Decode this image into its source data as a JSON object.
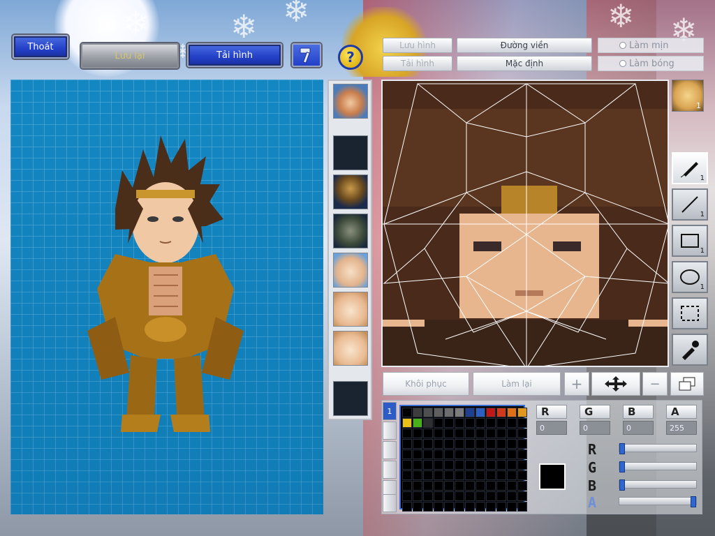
{
  "toolbar": {
    "exit_label": "Thoát",
    "save_label": "Lưu lại",
    "reload_label": "Tải hình",
    "hammer_icon": "hammer-icon",
    "help_icon": "help-icon",
    "help_glyph": "?"
  },
  "options": {
    "save_image": "Lưu hình",
    "load_image": "Tải hình",
    "outline": "Đường viền",
    "default": "Mặc định",
    "smooth": "Làm mịn",
    "shiny": "Làm bóng"
  },
  "editor": {
    "undo_label": "Khôi phục",
    "redo_label": "Làm lại",
    "face_badge": "1"
  },
  "tools": [
    {
      "name": "pen-icon",
      "count": "1",
      "active": true
    },
    {
      "name": "line-icon",
      "count": "1",
      "active": false
    },
    {
      "name": "rectangle-icon",
      "count": "1",
      "active": false
    },
    {
      "name": "ellipse-icon",
      "count": "1",
      "active": false
    },
    {
      "name": "selection-icon",
      "count": "",
      "active": false
    },
    {
      "name": "eyedropper-icon",
      "count": "",
      "active": false
    }
  ],
  "palette": {
    "tab_label": "1",
    "channels": {
      "R": {
        "label": "R",
        "value": "0"
      },
      "G": {
        "label": "G",
        "value": "0"
      },
      "B": {
        "label": "B",
        "value": "0"
      },
      "A": {
        "label": "A",
        "value": "255"
      }
    },
    "current_color": "#000000",
    "colors_row1": [
      "#000000",
      "#3d3d3d",
      "#4f4f4f",
      "#5e5e5e",
      "#6d6d6d",
      "#7c7c7c",
      "#1f3f8f",
      "#2f5fbf",
      "#c01818",
      "#d03a1a",
      "#e07018",
      "#e09820"
    ],
    "colors_row2": [
      "#e8c018",
      "#48b018",
      "#2f2f2f"
    ],
    "sliders": [
      {
        "label": "R",
        "level": 0.0
      },
      {
        "label": "G",
        "level": 0.0
      },
      {
        "label": "B",
        "level": 0.0
      },
      {
        "label": "A",
        "level": 1.0
      }
    ]
  }
}
